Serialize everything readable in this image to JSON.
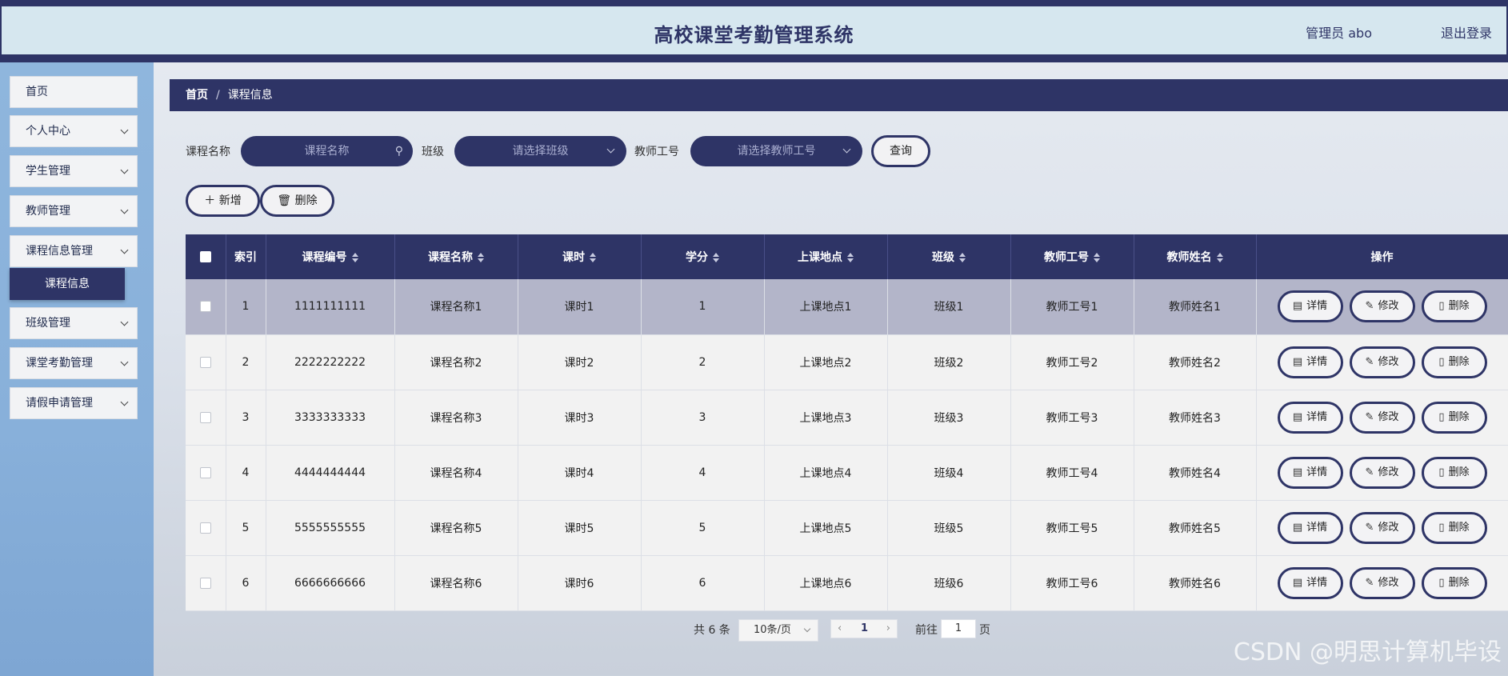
{
  "header": {
    "title": "高校课堂考勤管理系统",
    "user": "管理员 abo",
    "logout": "退出登录"
  },
  "sidebar": {
    "items": [
      {
        "label": "首页"
      },
      {
        "label": "个人中心"
      },
      {
        "label": "学生管理"
      },
      {
        "label": "教师管理"
      },
      {
        "label": "课程信息管理"
      },
      {
        "label": "班级管理"
      },
      {
        "label": "课堂考勤管理"
      },
      {
        "label": "请假申请管理"
      }
    ],
    "active_sub": "课程信息"
  },
  "breadcrumb": {
    "home": "首页",
    "separator": "/",
    "current": "课程信息"
  },
  "search": {
    "course_label": "课程名称",
    "course_placeholder": "课程名称",
    "class_label": "班级",
    "class_placeholder": "请选择班级",
    "teacher_label": "教师工号",
    "teacher_placeholder": "请选择教师工号",
    "query_button": "查询"
  },
  "actions": {
    "add_button": "新增",
    "delete_button": "删除"
  },
  "table": {
    "headers": [
      "索引",
      "课程编号",
      "课程名称",
      "课时",
      "学分",
      "上课地点",
      "班级",
      "教师工号",
      "教师姓名",
      "操作"
    ],
    "rows": [
      [
        "1",
        "1111111111",
        "课程名称1",
        "课时1",
        "1",
        "上课地点1",
        "班级1",
        "教师工号1",
        "教师姓名1"
      ],
      [
        "2",
        "2222222222",
        "课程名称2",
        "课时2",
        "2",
        "上课地点2",
        "班级2",
        "教师工号2",
        "教师姓名2"
      ],
      [
        "3",
        "3333333333",
        "课程名称3",
        "课时3",
        "3",
        "上课地点3",
        "班级3",
        "教师工号3",
        "教师姓名3"
      ],
      [
        "4",
        "4444444444",
        "课程名称4",
        "课时4",
        "4",
        "上课地点4",
        "班级4",
        "教师工号4",
        "教师姓名4"
      ],
      [
        "5",
        "5555555555",
        "课程名称5",
        "课时5",
        "5",
        "上课地点5",
        "班级5",
        "教师工号5",
        "教师姓名5"
      ],
      [
        "6",
        "6666666666",
        "课程名称6",
        "课时6",
        "6",
        "上课地点6",
        "班级6",
        "教师工号6",
        "教师姓名6"
      ]
    ],
    "ops": {
      "detail": "详情",
      "edit": "修改",
      "delete": "删除"
    }
  },
  "pagination": {
    "total": "共 6 条",
    "page_size": "10条/页",
    "current": "1",
    "goto": "前往",
    "goto_value": "1",
    "unit": "页"
  },
  "watermark": "CSDN @明思计算机毕设",
  "colors": {
    "primary": "#2e3466",
    "header_bg": "#d6e7ef",
    "sidebar_bg": "#8fb6dd",
    "row_highlight": "#b3b5c9"
  }
}
